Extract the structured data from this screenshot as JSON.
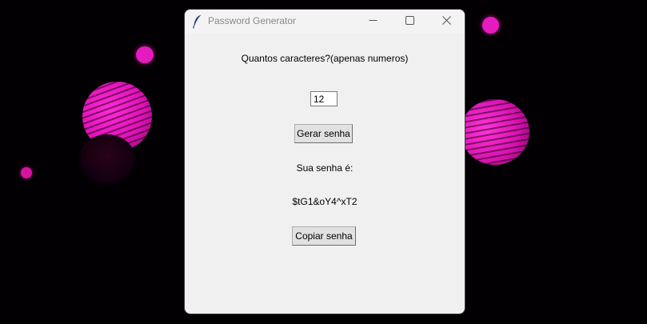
{
  "window": {
    "title": "Password Generator",
    "controls": {
      "minimize": "minimize-icon",
      "maximize": "maximize-icon",
      "close": "close-icon"
    },
    "app_icon": "feather-icon"
  },
  "form": {
    "length_prompt": "Quantos caracteres?(apenas numeros)",
    "length_value": "12",
    "generate_button": "Gerar senha",
    "result_heading": "Sua senha é:",
    "generated_password": "$tG1&oY4^xT2",
    "copy_button": "Copiar senha"
  },
  "colors": {
    "accent_magenta": "#e61bbf",
    "window_bg": "#f0f0f0",
    "desktop_bg": "#030003"
  }
}
